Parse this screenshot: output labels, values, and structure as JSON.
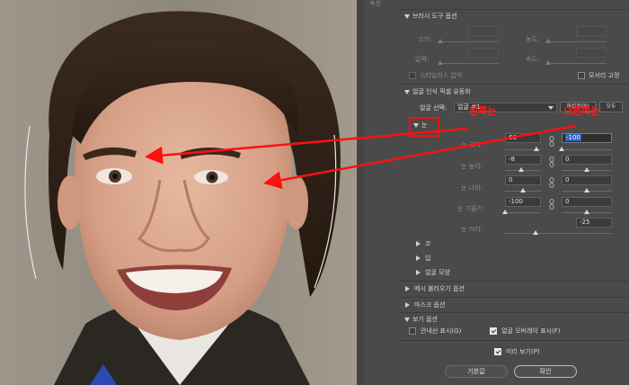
{
  "panel": {
    "header": "속성",
    "brush_section": {
      "title": "브러시 도구 옵션",
      "size_label": "크기:",
      "density_label": "농도:",
      "pressure_label": "압력:",
      "rate_label": "속도:",
      "stylus_label": "스타일러스 압력",
      "pin_edges_label": "모서리 고정"
    },
    "face_section": {
      "title": "얼굴 인식 픽셀 유동화",
      "select_label": "얼굴 선택:",
      "select_value": "얼굴 #1",
      "reset_label": "재설정(R)",
      "all_label": "모두",
      "eyes_label": "눈",
      "eye_size_label": "눈 크기:",
      "eye_height_label": "눈 높이:",
      "eye_width_label": "눈 너비:",
      "eye_tilt_label": "눈 기울기:",
      "eye_distance_label": "눈 거리:",
      "eye_size_left": "60",
      "eye_size_right": "-100",
      "eye_height_left": "-8",
      "eye_height_right": "0",
      "eye_width_left": "0",
      "eye_width_right": "0",
      "eye_tilt_left": "-100",
      "eye_tilt_right": "0",
      "eye_distance": "-25",
      "nose_label": "코",
      "mouth_label": "입",
      "face_shape_label": "얼굴 모양"
    },
    "mesh_section": {
      "title": "메시 불러오기 옵션"
    },
    "mask_section": {
      "title": "마스크 옵션"
    },
    "view_section": {
      "title": "보기 옵션",
      "show_guides_label": "안내선 표시(G)",
      "show_face_overlay_label": "얼굴 오버레이 표시(F)"
    },
    "preview_label": "미리 보기(P)",
    "default_button": "기본값",
    "ok_button": "확인"
  },
  "annotations": {
    "left_eye_label": "왼쪽눈",
    "right_eye_label": "오른쪽눈",
    "color": "#ff1010"
  }
}
